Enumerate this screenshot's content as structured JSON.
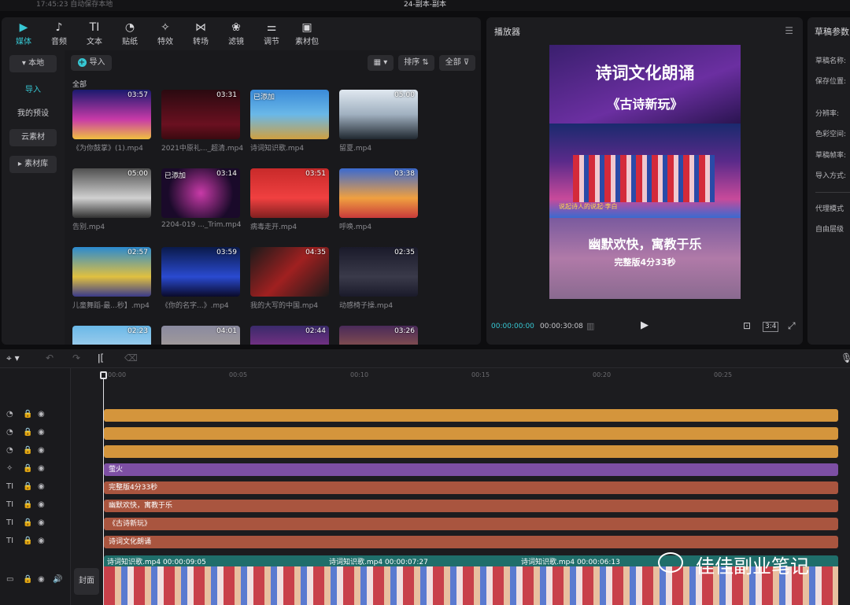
{
  "window": {
    "autosave": "17:45:23 自动保存本地",
    "title": "24-副本-副本"
  },
  "toolbar": {
    "items": [
      {
        "label": "媒体",
        "icon": "media-icon",
        "glyph": "▶"
      },
      {
        "label": "音频",
        "icon": "audio-icon",
        "glyph": "♪"
      },
      {
        "label": "文本",
        "icon": "text-icon",
        "glyph": "TI"
      },
      {
        "label": "贴纸",
        "icon": "sticker-icon",
        "glyph": "◔"
      },
      {
        "label": "特效",
        "icon": "effects-icon",
        "glyph": "✧"
      },
      {
        "label": "转场",
        "icon": "transition-icon",
        "glyph": "⋈"
      },
      {
        "label": "滤镜",
        "icon": "filter-icon",
        "glyph": "❀"
      },
      {
        "label": "调节",
        "icon": "adjust-icon",
        "glyph": "⚌"
      },
      {
        "label": "素材包",
        "icon": "package-icon",
        "glyph": "▣"
      }
    ]
  },
  "sidebar": {
    "items": [
      {
        "label": "▾ 本地"
      },
      {
        "label": "导入"
      },
      {
        "label": "我的预设"
      },
      {
        "label": "云素材"
      },
      {
        "label": "▸ 素材库"
      }
    ]
  },
  "media": {
    "import_label": "导入",
    "sort_label": "排序",
    "filter_label": "全部",
    "section_label": "全部",
    "added_label": "已添加",
    "items": [
      {
        "name": "《为你鼓掌》(1).mp4",
        "duration": "03:57",
        "added": false
      },
      {
        "name": "2021中原礼..._超清.mp4",
        "duration": "03:31",
        "added": false
      },
      {
        "name": "诗词知识歌.mp4",
        "duration": "",
        "added": true
      },
      {
        "name": "留夏.mp4",
        "duration": "05:00",
        "added": false
      },
      {
        "name": "告别.mp4",
        "duration": "05:00",
        "added": false
      },
      {
        "name": "2204-019 ..._Trim.mp4",
        "duration": "03:14",
        "added": true
      },
      {
        "name": "病毒走开.mp4",
        "duration": "03:51",
        "added": false
      },
      {
        "name": "呼唤.mp4",
        "duration": "03:38",
        "added": false
      },
      {
        "name": "儿童舞蹈-最...秒】.mp4",
        "duration": "02:57",
        "added": false
      },
      {
        "name": "《你的名字...》.mp4",
        "duration": "03:59",
        "added": false
      },
      {
        "name": "我的大写的中国.mp4",
        "duration": "04:35",
        "added": false
      },
      {
        "name": "动感椅子操.mp4",
        "duration": "02:35",
        "added": false
      },
      {
        "name": "",
        "duration": "02:23",
        "added": false
      },
      {
        "name": "",
        "duration": "04:01",
        "added": false
      },
      {
        "name": "",
        "duration": "02:44",
        "added": false
      },
      {
        "name": "",
        "duration": "03:26",
        "added": false
      }
    ]
  },
  "player": {
    "title": "播放器",
    "current_time": "00:00:00:00",
    "total_time": "00:00:30:08",
    "ratio_label": "3:4",
    "poster": {
      "title": "诗词文化朗诵",
      "subtitle": "《古诗新玩》",
      "stage_caption": "说起诗人的说起·李白",
      "slogan": "幽默欢快，寓教于乐",
      "version": "完整版4分33秒"
    }
  },
  "draft": {
    "title": "草稿参数",
    "fields": [
      "草稿名称:",
      "保存位置:",
      "分辨率:",
      "色彩空间:",
      "草稿帧率:",
      "导入方式:",
      "代理模式",
      "自由层级"
    ]
  },
  "timeline": {
    "ticks": [
      "00:00",
      "00:05",
      "00:10",
      "00:15",
      "00:20",
      "00:25"
    ],
    "cover_label": "封面",
    "tracks": [
      {
        "type": "sticker",
        "label": "",
        "color": "#d4953c"
      },
      {
        "type": "sticker",
        "label": "",
        "color": "#d4953c"
      },
      {
        "type": "sticker",
        "label": "",
        "color": "#d4953c"
      },
      {
        "type": "effect",
        "label": "萤火",
        "color": "#7d4fa4"
      },
      {
        "type": "text",
        "label": "完整版4分33秒",
        "color": "#a9553f"
      },
      {
        "type": "text",
        "label": "幽默欢快，寓教于乐",
        "color": "#a9553f"
      },
      {
        "type": "text",
        "label": "《古诗新玩》",
        "color": "#a9553f"
      },
      {
        "type": "text",
        "label": "诗词文化朗诵",
        "color": "#a9553f"
      }
    ],
    "video_clips": [
      {
        "name": "诗词知识歌.mp4",
        "duration": "00:00:09:05"
      },
      {
        "name": "诗词知识歌.mp4",
        "duration": "00:00:07:27"
      },
      {
        "name": "诗词知识歌.mp4",
        "duration": "00:00:06:13"
      }
    ]
  },
  "watermark": "佳佳副业笔记",
  "colors": {
    "accent": "#37c8d4",
    "sticker": "#d4953c",
    "effect": "#7d4fa4",
    "text": "#a9553f",
    "video": "#1f6e6a"
  }
}
